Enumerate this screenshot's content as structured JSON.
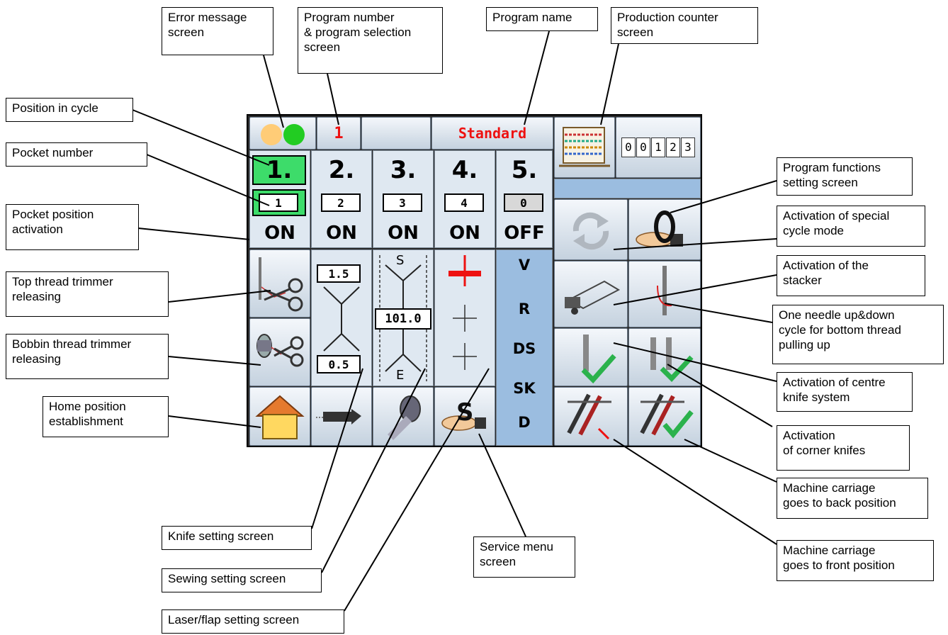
{
  "panel": {
    "program_number": "1",
    "program_name": "Standard",
    "counter_digits": [
      "0",
      "0",
      "1",
      "2",
      "3"
    ],
    "pockets": [
      {
        "label": "1.",
        "number": "1",
        "status": "ON"
      },
      {
        "label": "2.",
        "number": "2",
        "status": "ON"
      },
      {
        "label": "3.",
        "number": "3",
        "status": "ON"
      },
      {
        "label": "4.",
        "number": "4",
        "status": "ON"
      },
      {
        "label": "5.",
        "number": "0",
        "status": "OFF"
      }
    ],
    "knife_top": "1.5",
    "knife_bottom": "0.5",
    "sewing_value": "101.0",
    "sewing_top": "S",
    "sewing_bottom": "E",
    "cycle_letters": [
      "V",
      "R",
      "DS",
      "SK",
      "D"
    ],
    "colors": {
      "active_green": "#3ddc6a",
      "program_red": "#ee1111",
      "cycle_blue": "#9bbde0",
      "status_orange": "#ffcc77",
      "status_green": "#22cc22"
    }
  },
  "callouts": {
    "error_message": "Error message\nscreen",
    "program_number": "Program number\n& program selection\nscreen",
    "program_name": "Program name",
    "production_counter": "Production counter\nscreen",
    "position_in_cycle": "Position in cycle",
    "pocket_number": "Pocket number",
    "pocket_position": "Pocket position\nactivation",
    "top_thread": "Top thread trimmer\nreleasing",
    "bobbin_thread": "Bobbin thread trimmer\nreleasing",
    "home_position": "Home position\nestablishment",
    "program_functions": "Program functions\nsetting screen",
    "special_cycle": "Activation of special\ncycle mode",
    "stacker": "Activation of the\nstacker",
    "one_needle": "One needle up&down\ncycle for bottom thread\npulling up",
    "centre_knife": "Activation of centre\nknife system",
    "corner_knifes": "Activation\nof corner knifes",
    "carriage_back": "Machine carriage\ngoes to back position",
    "carriage_front": "Machine carriage\ngoes to front position",
    "knife_setting": "Knife setting screen",
    "sewing_setting": "Sewing setting screen",
    "laser_setting": "Laser/flap setting screen",
    "service_menu": "Service menu\nscreen"
  }
}
